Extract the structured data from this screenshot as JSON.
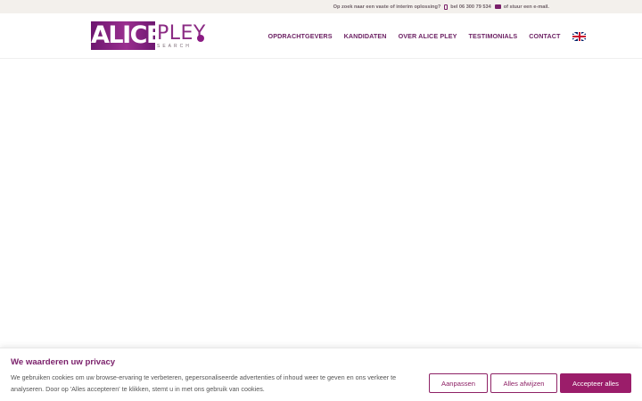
{
  "topbar": {
    "question": "Op zoek naar een vaste of interim oplossing?",
    "phone": "bel 06 300 79 534",
    "email": "of stuur een e-mail."
  },
  "logo": {
    "alice": "ALICE",
    "pley": "PLEY",
    "tagline": "SEARCH"
  },
  "nav": {
    "items": [
      {
        "label": "OPDRACHTGEVERS"
      },
      {
        "label": "KANDIDATEN"
      },
      {
        "label": "OVER ALICE PLEY"
      },
      {
        "label": "TESTIMONIALS"
      },
      {
        "label": "CONTACT"
      }
    ],
    "language_icon": "uk-flag-icon"
  },
  "cookie": {
    "title": "We waarderen uw privacy",
    "text": "We gebruiken cookies om uw browse-ervaring te verbeteren, gepersonaliseerde advertenties of inhoud weer te geven en ons verkeer te analyseren. Door op 'Alles accepteren' te klikken, stemt u in met ons gebruik van cookies.",
    "customize": "Aanpassen",
    "reject": "Alles afwijzen",
    "accept": "Accepteer alles"
  },
  "colors": {
    "brand": "#7a1f6a",
    "accent_button": "#9b1d6a",
    "topbar_bg": "#f3f0ec"
  }
}
